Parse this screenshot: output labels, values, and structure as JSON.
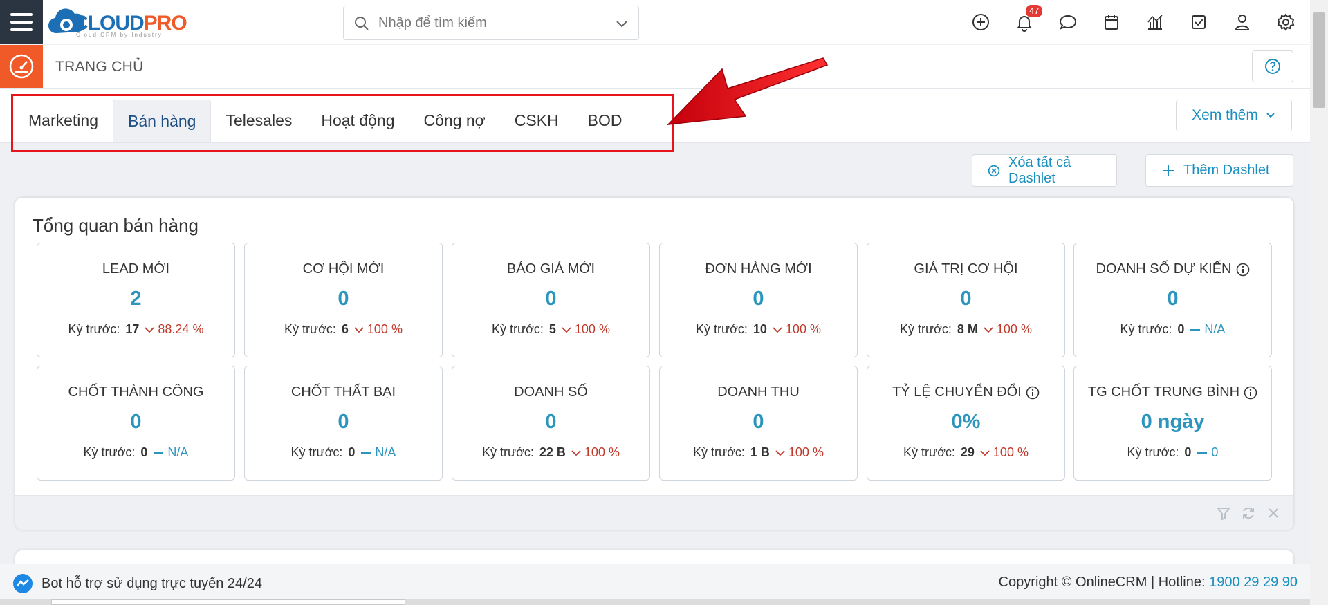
{
  "brand": {
    "logo_part1": "CLOUD",
    "logo_part2": "PRO",
    "tagline": "Cloud CRM by Industry"
  },
  "search": {
    "placeholder": "Nhập để tìm kiếm"
  },
  "topbar": {
    "notification_count": "47"
  },
  "page": {
    "title": "TRANG CHỦ"
  },
  "tabs": [
    "Marketing",
    "Bán hàng",
    "Telesales",
    "Hoạt động",
    "Công nợ",
    "CSKH",
    "BOD"
  ],
  "active_tab": "Bán hàng",
  "more_button": "Xem thêm",
  "actions": {
    "clear_all": "Xóa tất cả Dashlet",
    "add": "Thêm Dashlet"
  },
  "dashlet": {
    "title": "Tổng quan bán hàng",
    "cards": [
      {
        "label": "LEAD MỚI",
        "value": "2",
        "prev_label": "Kỳ trước:",
        "prev_value": "17",
        "change": "88.24 %",
        "trend": "down",
        "info": false
      },
      {
        "label": "CƠ HỘI MỚI",
        "value": "0",
        "prev_label": "Kỳ trước:",
        "prev_value": "6",
        "change": "100 %",
        "trend": "down",
        "info": false
      },
      {
        "label": "BÁO GIÁ MỚI",
        "value": "0",
        "prev_label": "Kỳ trước:",
        "prev_value": "5",
        "change": "100 %",
        "trend": "down",
        "info": false
      },
      {
        "label": "ĐƠN HÀNG MỚI",
        "value": "0",
        "prev_label": "Kỳ trước:",
        "prev_value": "10",
        "change": "100 %",
        "trend": "down",
        "info": false
      },
      {
        "label": "GIÁ TRỊ CƠ HỘI",
        "value": "0",
        "prev_label": "Kỳ trước:",
        "prev_value": "8 M",
        "change": "100 %",
        "trend": "down",
        "info": false
      },
      {
        "label": "DOANH SỐ DỰ KIẾN",
        "value": "0",
        "prev_label": "Kỳ trước:",
        "prev_value": "0",
        "change": "N/A",
        "trend": "flat",
        "info": true
      },
      {
        "label": "CHỐT THÀNH CÔNG",
        "value": "0",
        "prev_label": "Kỳ trước:",
        "prev_value": "0",
        "change": "N/A",
        "trend": "flat",
        "info": false
      },
      {
        "label": "CHỐT THẤT BẠI",
        "value": "0",
        "prev_label": "Kỳ trước:",
        "prev_value": "0",
        "change": "N/A",
        "trend": "flat",
        "info": false
      },
      {
        "label": "DOANH SỐ",
        "value": "0",
        "prev_label": "Kỳ trước:",
        "prev_value": "22 B",
        "change": "100 %",
        "trend": "down",
        "info": false
      },
      {
        "label": "DOANH THU",
        "value": "0",
        "prev_label": "Kỳ trước:",
        "prev_value": "1 B",
        "change": "100 %",
        "trend": "down",
        "info": false
      },
      {
        "label": "TỶ LỆ CHUYỂN ĐỔI",
        "value": "0%",
        "prev_label": "Kỳ trước:",
        "prev_value": "29",
        "change": "100 %",
        "trend": "down",
        "info": true
      },
      {
        "label": "TG CHỐT TRUNG BÌNH",
        "value": "0 ngày",
        "prev_label": "Kỳ trước:",
        "prev_value": "0",
        "change": "0",
        "trend": "flat",
        "info": true
      }
    ]
  },
  "footer": {
    "bot_text": "Bot hỗ trợ sử dụng trực tuyến 24/24",
    "copyright": "Copyright © OnlineCRM | Hotline: ",
    "hotline": "1900 29 29 90"
  },
  "colors": {
    "accent": "#f05a28",
    "primary": "#1c6fb5",
    "value_blue": "#2b95bd",
    "down_red": "#c0392b",
    "highlight_red": "#e8141c"
  }
}
